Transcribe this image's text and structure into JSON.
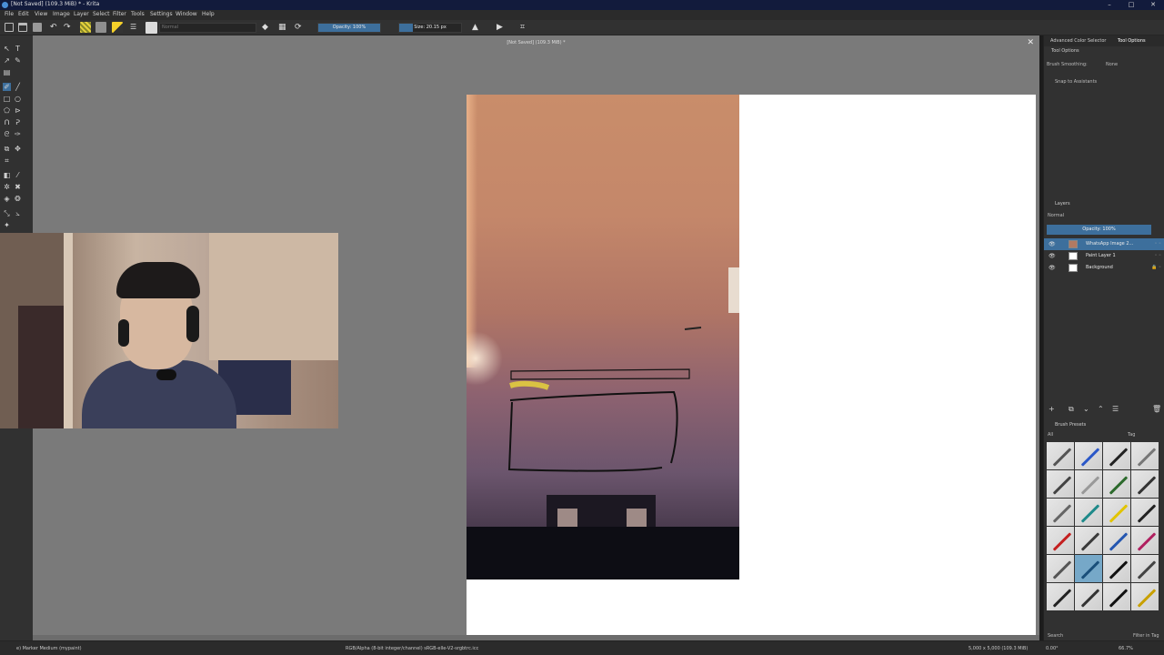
{
  "window": {
    "title": "[Not Saved]  (109.3 MiB) * - Krita",
    "controls": [
      "–",
      "□",
      "✕"
    ]
  },
  "menu": [
    "File",
    "Edit",
    "View",
    "Image",
    "Layer",
    "Select",
    "Filter",
    "Tools",
    "Settings",
    "Window",
    "Help"
  ],
  "toolbar": {
    "blend_mode": "Normal",
    "opacity_label": "Opacity: 100%",
    "opacity_value": 100,
    "size_label": "Size: 20.15 px",
    "accent_color": "#3d6f9c",
    "foreground_color": "#f5d02a"
  },
  "document": {
    "title": "[Not Saved]  (109.3 MiB) *",
    "close_glyph": "✕"
  },
  "dock": {
    "tab_color_selector": "Advanced Color Selector",
    "tab_tool_options": "Tool Options",
    "tool_options_title": "Tool Options",
    "brush_smoothing_label": "Brush Smoothing:",
    "brush_smoothing_value": "None",
    "snap_label": "Snap to Assistants",
    "layers_title": "Layers",
    "layers_blend": "Normal",
    "layers_opacity": "Opacity: 100%",
    "layers": [
      {
        "name": "WhatsApp Image 2...",
        "active": true
      },
      {
        "name": "Paint Layer 1",
        "active": false
      },
      {
        "name": "Background",
        "active": false
      }
    ],
    "presets_title": "Brush Presets",
    "presets_filter": "All",
    "presets_tag": "Tag",
    "search_label": "Search",
    "filter_in_tag": "Filter in Tag"
  },
  "status": {
    "brush": "e) Marker Medium (mypaint)",
    "color_profile": "RGB/Alpha (8-bit integer/channel)  sRGB-elle-V2-srgbtrc.icc",
    "dimensions": "5,000 x 5,000 (109.3 MiB)",
    "rotation": "0.00°",
    "zoom": "66.7%"
  }
}
